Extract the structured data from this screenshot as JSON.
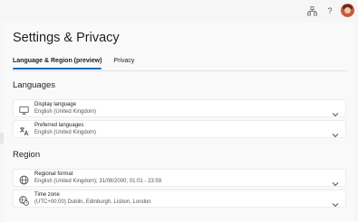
{
  "header": {
    "icons": [
      "org-chart-icon",
      "help-icon",
      "avatar"
    ],
    "help_label": "?"
  },
  "page": {
    "title": "Settings & Privacy",
    "tabs": [
      {
        "label": "Language & Region (preview)",
        "active": true
      },
      {
        "label": "Privacy",
        "active": false
      }
    ]
  },
  "languages": {
    "title": "Languages",
    "items": [
      {
        "label": "Display language",
        "value": "English (United Kingdom)",
        "icon": "monitor-icon"
      },
      {
        "label": "Preferred languages",
        "value": "English (United Kingdom)",
        "icon": "translate-icon"
      }
    ]
  },
  "region": {
    "title": "Region",
    "items": [
      {
        "label": "Regional format",
        "value": "English (United Kingdom); 31/08/2000; 01:01 - 23:59",
        "icon": "globe-icon"
      },
      {
        "label": "Time zone",
        "value": "(UTC+00:00) Dublin, Edinburgh, Lisbon, London",
        "icon": "globe-clock-icon"
      }
    ]
  },
  "colors": {
    "accent": "#0f6cbd",
    "background": "#f9f9f9"
  }
}
